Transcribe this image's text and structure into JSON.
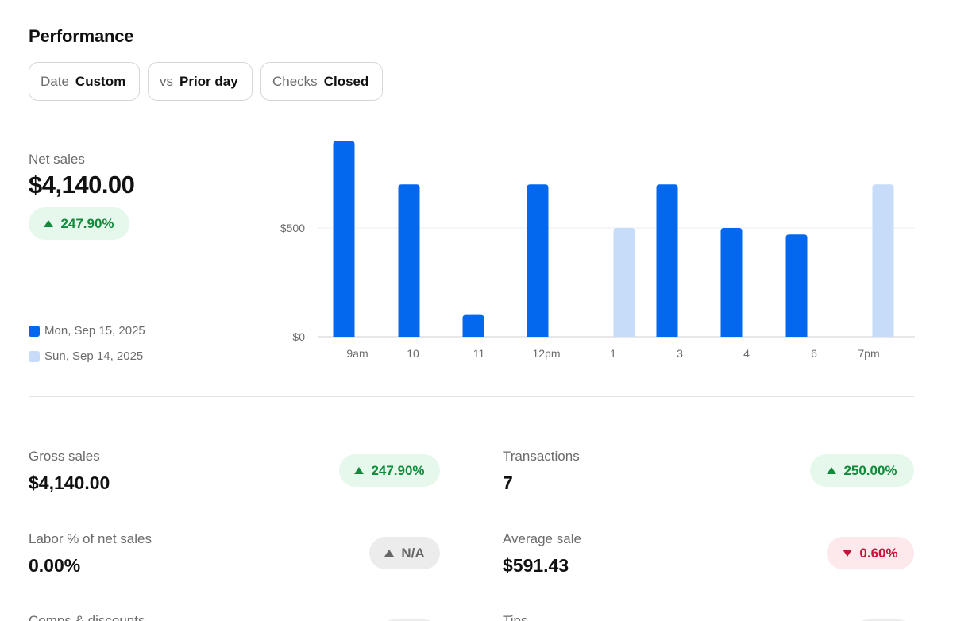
{
  "title": "Performance",
  "filters": [
    {
      "key": "Date",
      "value": "Custom"
    },
    {
      "key": "vs",
      "value": "Prior day"
    },
    {
      "key": "Checks",
      "value": "Closed"
    }
  ],
  "net_sales": {
    "label": "Net sales",
    "value": "$4,140.00",
    "change": "247.90%",
    "direction": "up"
  },
  "legend": [
    {
      "label": "Mon, Sep 15, 2025",
      "color": "#0468ee"
    },
    {
      "label": "Sun, Sep 14, 2025",
      "color": "#c6dcf9"
    }
  ],
  "chart_data": {
    "type": "bar",
    "categories": [
      "9am",
      "10",
      "11",
      "12pm",
      "1",
      "3",
      "4",
      "6",
      "7pm"
    ],
    "series": [
      {
        "name": "Mon, Sep 15, 2025",
        "color": "#0468ee",
        "values": [
          900,
          700,
          100,
          700,
          null,
          700,
          500,
          470,
          null
        ]
      },
      {
        "name": "Sun, Sep 14, 2025",
        "color": "#c6dcf9",
        "values": [
          null,
          null,
          null,
          null,
          500,
          null,
          null,
          null,
          700
        ]
      }
    ],
    "y_ticks": [
      {
        "value": 0,
        "label": "$0"
      },
      {
        "value": 500,
        "label": "$500"
      }
    ],
    "ylim": [
      0,
      900
    ],
    "grid": true
  },
  "metrics": [
    {
      "label": "Gross sales",
      "value": "$4,140.00",
      "change": "247.90%",
      "direction": "up"
    },
    {
      "label": "Transactions",
      "value": "7",
      "change": "250.00%",
      "direction": "up"
    },
    {
      "label": "Labor % of net sales",
      "value": "0.00%",
      "change": "N/A",
      "direction": "na"
    },
    {
      "label": "Average sale",
      "value": "$591.43",
      "change": "0.60%",
      "direction": "down"
    },
    {
      "label": "Comps & discounts",
      "value": "",
      "change": "",
      "direction": "na"
    },
    {
      "label": "Tips",
      "value": "",
      "change": "",
      "direction": "na"
    }
  ]
}
